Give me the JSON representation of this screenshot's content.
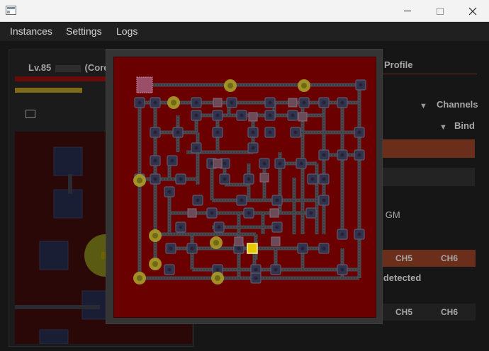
{
  "window": {
    "title": ""
  },
  "menu": {
    "items": [
      "Instances",
      "Settings",
      "Logs"
    ]
  },
  "character": {
    "name": "Lv.85",
    "tag": "(Core="
  },
  "tabs": {
    "profile": "Profile"
  },
  "labels": {
    "channels": "Channels",
    "bind": "Bind",
    "gm": "ct GM",
    "detected": "s detected",
    "ch5": "CH5",
    "ch6": "CH6"
  },
  "colors": {
    "map_background": "#6b0000",
    "corridor": "#4a4a52",
    "room": "#33334d",
    "unexplored_room": "#6b4b58",
    "portal": "#a89d28",
    "player": "#e5c800",
    "accent": "#6b2e1a"
  },
  "map": {
    "player_icon": "player-marker",
    "portal_icon": "portal-marker",
    "room_icon": "room-marker",
    "start_icon": "start-room-marker"
  }
}
